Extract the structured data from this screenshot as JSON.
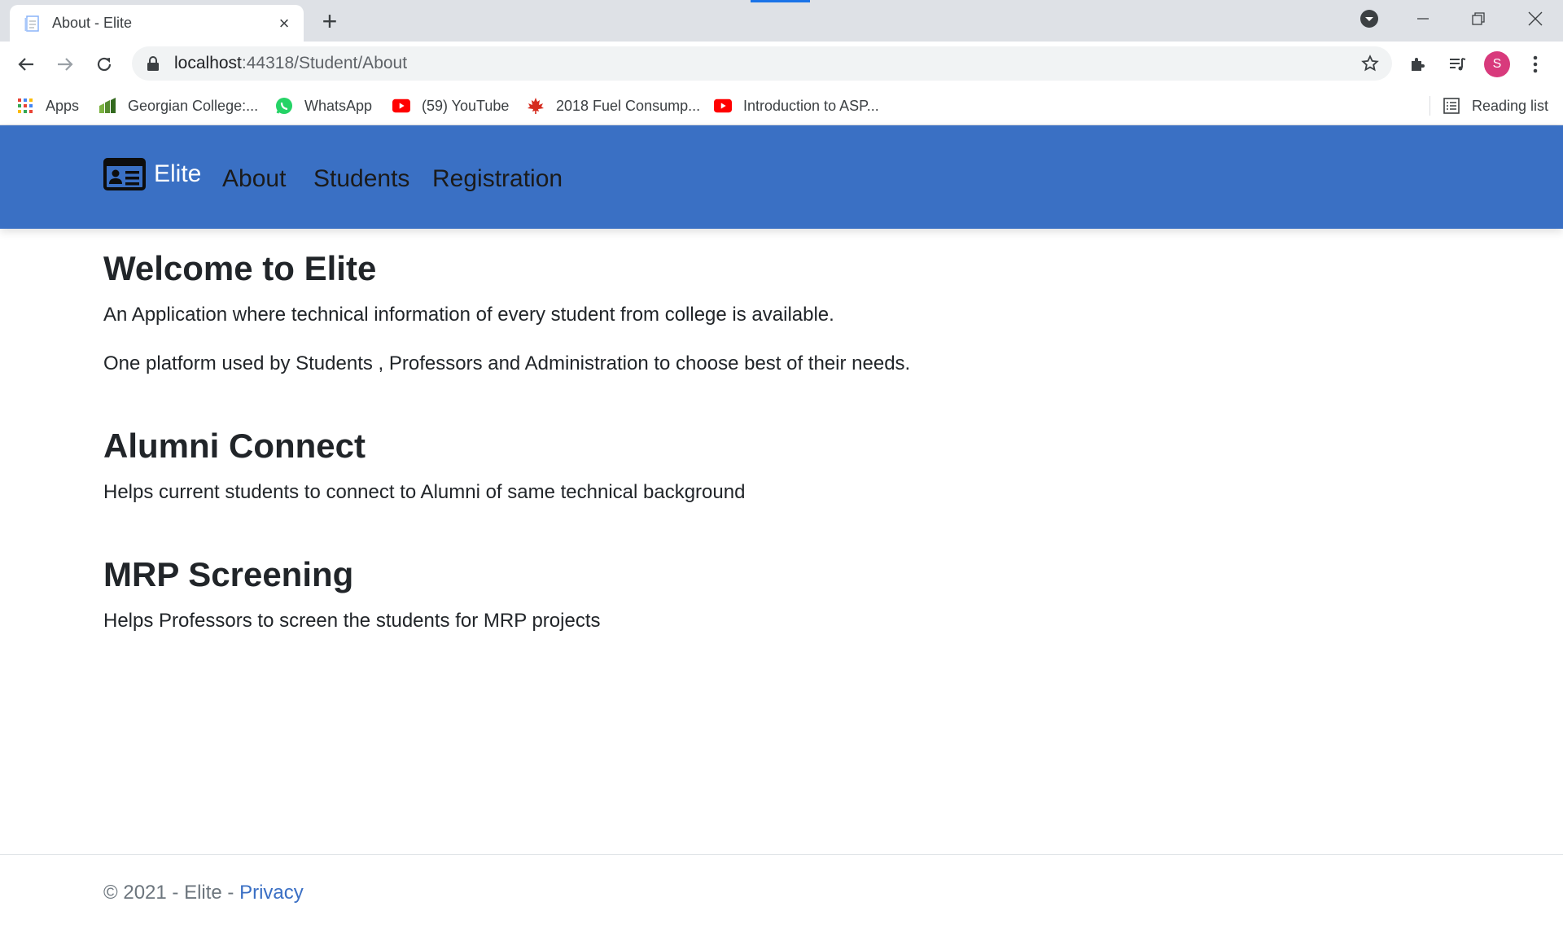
{
  "browser": {
    "tab_title": "About - Elite",
    "url_host": "localhost",
    "url_rest": ":44318/Student/About",
    "profile_initial": "S",
    "bookmarks": [
      {
        "label": "Apps",
        "icon": "apps-grid-icon"
      },
      {
        "label": "Georgian College:...",
        "icon": "georgian-college-icon"
      },
      {
        "label": "WhatsApp",
        "icon": "whatsapp-icon"
      },
      {
        "label": "(59) YouTube",
        "icon": "youtube-icon"
      },
      {
        "label": "2018 Fuel Consump...",
        "icon": "maple-leaf-icon"
      },
      {
        "label": "Introduction to ASP...",
        "icon": "youtube-icon"
      }
    ],
    "reading_list": "Reading list"
  },
  "navbar": {
    "brand": "Elite",
    "links": [
      "About",
      "Students",
      "Registration"
    ],
    "background": "#3a70c4"
  },
  "main": {
    "welcome_heading": "Welcome to Elite",
    "welcome_p1": "An Application where technical information of every student from college is available.",
    "welcome_p2": "One platform used by Students , Professors and Administration to choose best of their needs.",
    "alumni_heading": "Alumni Connect",
    "alumni_p": "Helps current students to connect to Alumni of same technical background",
    "mrp_heading": "MRP Screening",
    "mrp_p": "Helps Professors to screen the students for MRP projects"
  },
  "footer": {
    "copyright": "© 2021 - Elite - ",
    "privacy": "Privacy"
  }
}
